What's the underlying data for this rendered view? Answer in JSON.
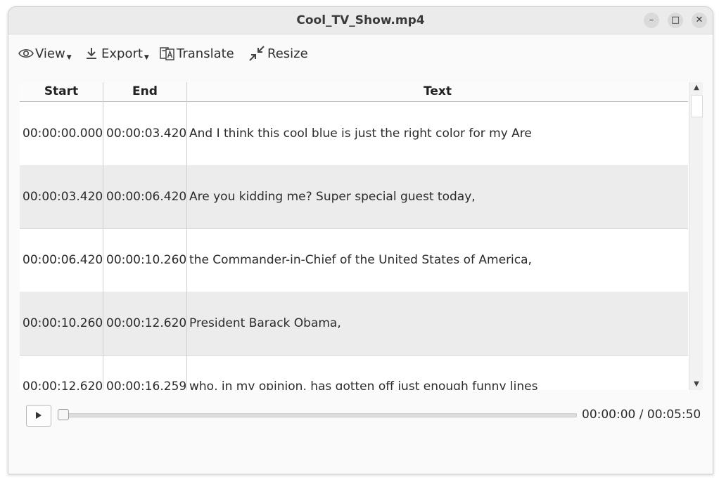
{
  "window": {
    "title": "Cool_TV_Show.mp4",
    "controls": {
      "minimize": "–",
      "maximize": "□",
      "close": "✕"
    }
  },
  "toolbar": {
    "view_label": "View",
    "export_label": "Export",
    "translate_label": "Translate",
    "resize_label": "Resize",
    "icons": [
      "eye-icon",
      "download-icon",
      "translate-icon",
      "shrink-icon"
    ]
  },
  "table": {
    "headers": {
      "start": "Start",
      "end": "End",
      "text": "Text"
    },
    "rows": [
      {
        "start": "00:00:00.000",
        "end": "00:00:03.420",
        "text": "And I think this cool blue is just the right color for my Are"
      },
      {
        "start": "00:00:03.420",
        "end": "00:00:06.420",
        "text": "Are you kidding me? Super special guest today,"
      },
      {
        "start": "00:00:06.420",
        "end": "00:00:10.260",
        "text": "the Commander-in-Chief of the United States of America,"
      },
      {
        "start": "00:00:10.260",
        "end": "00:00:12.620",
        "text": "President Barack Obama,"
      },
      {
        "start": "00:00:12.620",
        "end": "00:00:16.259",
        "text": "who, in my opinion, has gotten off just enough funny lines"
      }
    ]
  },
  "player": {
    "time_display": "00:00:00 / 00:05:50",
    "progress": 0
  },
  "colors": {
    "row_alt": "#ececec",
    "titlebar": "#ebebeb",
    "background": "#fafafa"
  }
}
